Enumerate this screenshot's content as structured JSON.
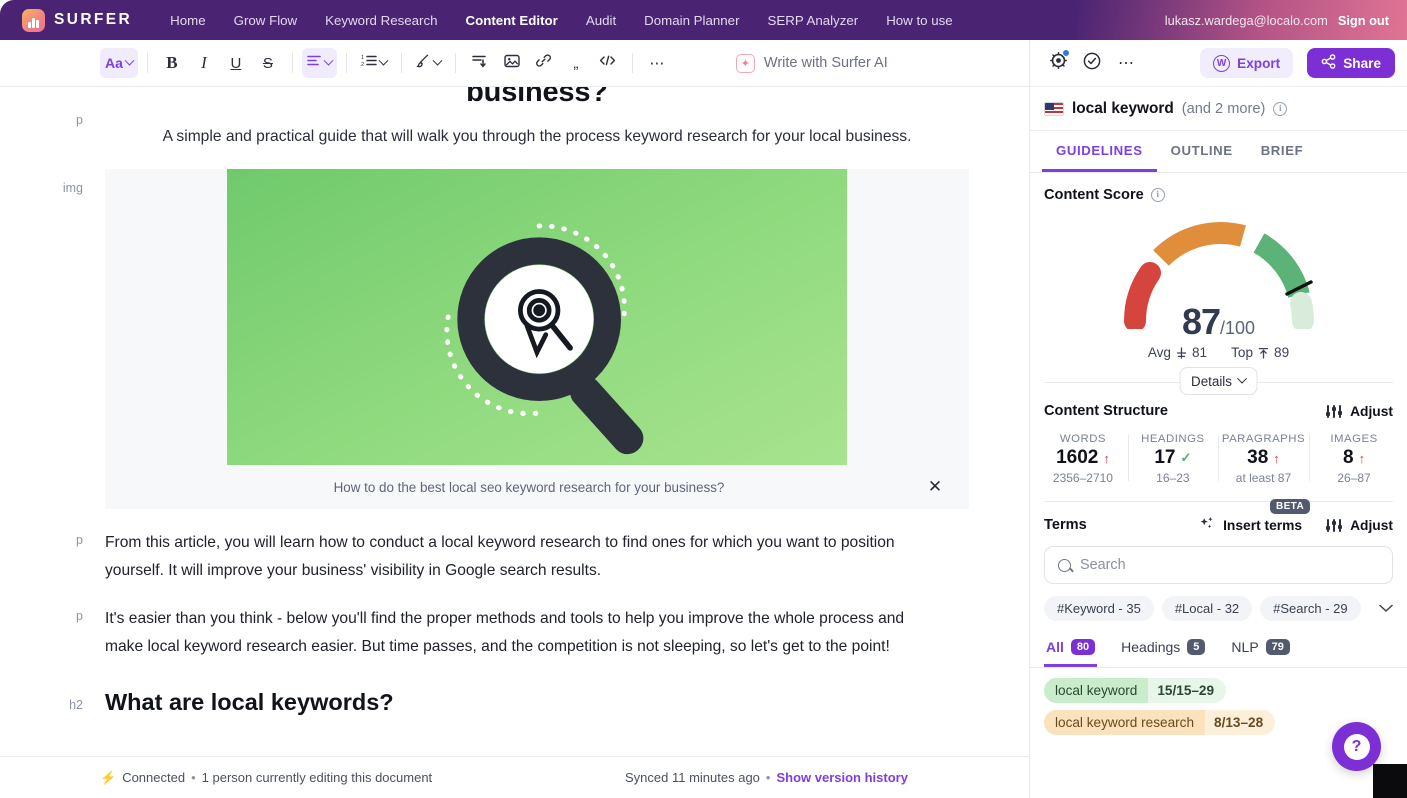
{
  "topnav": {
    "brand": "SURFER",
    "links": [
      {
        "label": "Home",
        "active": false
      },
      {
        "label": "Grow Flow",
        "active": false
      },
      {
        "label": "Keyword Research",
        "active": false
      },
      {
        "label": "Content Editor",
        "active": true
      },
      {
        "label": "Audit",
        "active": false
      },
      {
        "label": "Domain Planner",
        "active": false
      },
      {
        "label": "SERP Analyzer",
        "active": false
      },
      {
        "label": "How to use",
        "active": false
      }
    ],
    "user_email": "lukasz.wardega@localo.com",
    "sign_out": "Sign out"
  },
  "toolbar": {
    "font_label": "Aa",
    "bold": "B",
    "italic": "I",
    "underline": "U",
    "strike": "S",
    "ai_label": "Write with Surfer AI"
  },
  "document": {
    "heading_clipped": "business?",
    "lead_paragraph": "A simple and practical guide that will walk you through the process keyword research for your local business.",
    "gutter_p": "p",
    "gutter_img": "img",
    "gutter_h2": "h2",
    "image_caption": "How to do the best local seo keyword research for your business?",
    "paragraph_1": "From this article, you will learn how to conduct a local keyword research to find ones for which you want to position yourself. It will improve your business' visibility in Google search results.",
    "paragraph_2": "It's easier than you think - below you'll find the proper methods and tools to help you improve the whole process and make local keyword research easier. But time passes, and the competition is not sleeping, so let's get to the point!",
    "heading_2": "What are local keywords?"
  },
  "statusbar": {
    "connected": "Connected",
    "sep": "•",
    "editing": "1 person currently editing this document",
    "synced": "Synced 11 minutes ago",
    "version_link": "Show version history"
  },
  "panel": {
    "export_label": "Export",
    "share_label": "Share",
    "keyword": "local keyword",
    "keyword_more": "(and 2 more)",
    "tabs": [
      {
        "label": "GUIDELINES",
        "active": true
      },
      {
        "label": "OUTLINE",
        "active": false
      },
      {
        "label": "BRIEF",
        "active": false
      }
    ],
    "content_score": {
      "title": "Content Score",
      "score": "87",
      "max": "/100",
      "avg_label": "Avg",
      "avg_value": "81",
      "top_label": "Top",
      "top_value": "89",
      "details_label": "Details",
      "colors": {
        "red": "#d6453d",
        "orange": "#e08e3c",
        "green": "#5cb377",
        "track": "#d9ecdc",
        "needle": "#111111"
      }
    },
    "content_structure": {
      "title": "Content Structure",
      "adjust_label": "Adjust",
      "stats": [
        {
          "label": "WORDS",
          "value": "1602",
          "status": "up",
          "range": "2356–2710"
        },
        {
          "label": "HEADINGS",
          "value": "17",
          "status": "check",
          "range": "16–23"
        },
        {
          "label": "PARAGRAPHS",
          "value": "38",
          "status": "up",
          "range": "at least 87"
        },
        {
          "label": "IMAGES",
          "value": "8",
          "status": "up",
          "range": "26–87"
        }
      ]
    },
    "terms": {
      "title": "Terms",
      "insert_label": "Insert terms",
      "beta_badge": "BETA",
      "adjust_label": "Adjust",
      "search_placeholder": "Search",
      "search_value": "",
      "chips": [
        {
          "label": "#Keyword - 35"
        },
        {
          "label": "#Local - 32"
        },
        {
          "label": "#Search - 29"
        }
      ],
      "subtabs": [
        {
          "label": "All",
          "count": "80",
          "active": true
        },
        {
          "label": "Headings",
          "count": "5",
          "active": false
        },
        {
          "label": "NLP",
          "count": "79",
          "active": false
        }
      ],
      "items": [
        {
          "name": "local keyword",
          "value": "15/15–29",
          "tone": "green"
        },
        {
          "name": "local keyword research",
          "value": "8/13–28",
          "tone": "orange"
        }
      ]
    },
    "help_label": "?"
  }
}
